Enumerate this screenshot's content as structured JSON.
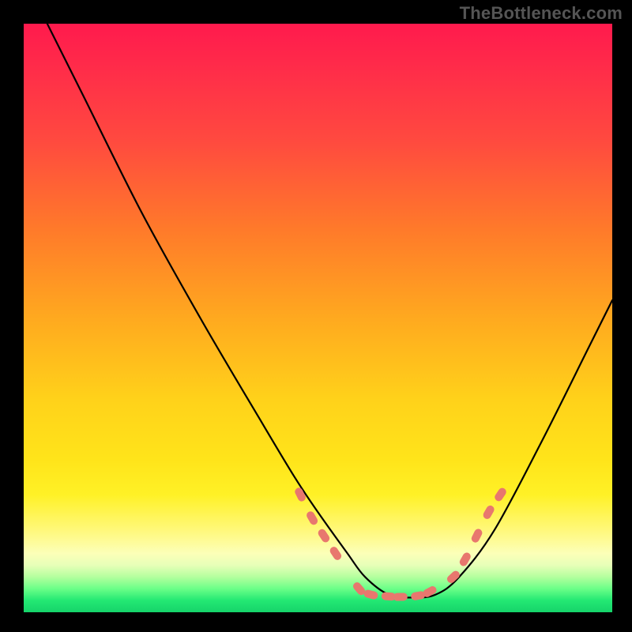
{
  "watermark": "TheBottleneck.com",
  "chart_data": {
    "type": "line",
    "title": "",
    "xlabel": "",
    "ylabel": "",
    "xlim": [
      0,
      100
    ],
    "ylim": [
      0,
      100
    ],
    "grid": false,
    "legend": false,
    "series": [
      {
        "name": "bottleneck-curve",
        "x": [
          4,
          10,
          20,
          30,
          40,
          46,
          50,
          55,
          58,
          62,
          66,
          70,
          74,
          80,
          88,
          96,
          100
        ],
        "y": [
          100,
          88,
          68,
          50,
          33,
          23,
          17,
          10,
          6,
          3,
          2.5,
          3,
          6,
          14,
          29,
          45,
          53
        ],
        "color": "#000000"
      }
    ],
    "markers": [
      {
        "name": "highlighted-points",
        "shape": "rounded-bead",
        "color": "#e8776e",
        "points": [
          {
            "x": 47,
            "y": 20
          },
          {
            "x": 49,
            "y": 16
          },
          {
            "x": 51,
            "y": 13
          },
          {
            "x": 53,
            "y": 10
          },
          {
            "x": 57,
            "y": 4
          },
          {
            "x": 59,
            "y": 3
          },
          {
            "x": 62,
            "y": 2.7
          },
          {
            "x": 64,
            "y": 2.6
          },
          {
            "x": 67,
            "y": 2.8
          },
          {
            "x": 69,
            "y": 3.5
          },
          {
            "x": 73,
            "y": 6
          },
          {
            "x": 75,
            "y": 9
          },
          {
            "x": 77,
            "y": 13
          },
          {
            "x": 79,
            "y": 17
          },
          {
            "x": 81,
            "y": 20
          }
        ]
      }
    ],
    "gradient_background": {
      "orientation": "vertical",
      "stops": [
        {
          "pos": 0.0,
          "color": "#ff1a4d"
        },
        {
          "pos": 0.35,
          "color": "#ff7a2a"
        },
        {
          "pos": 0.64,
          "color": "#ffd21a"
        },
        {
          "pos": 0.9,
          "color": "#fcffb8"
        },
        {
          "pos": 0.96,
          "color": "#6bff88"
        },
        {
          "pos": 1.0,
          "color": "#16d46a"
        }
      ]
    }
  }
}
